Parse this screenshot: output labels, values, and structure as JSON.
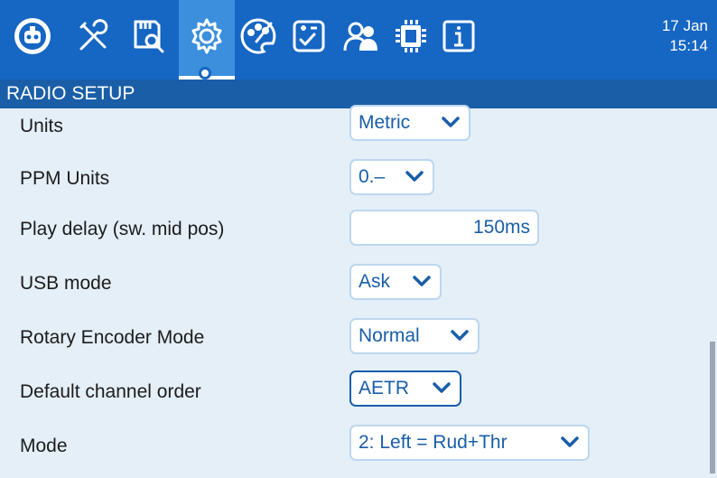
{
  "header": {
    "date": "17 Jan",
    "time": "15:14",
    "tabs": [
      {
        "icon": "radio-icon"
      },
      {
        "icon": "tools-icon"
      },
      {
        "icon": "sd-card-icon"
      },
      {
        "icon": "gear-icon",
        "active": true
      },
      {
        "icon": "theme-palette-icon"
      },
      {
        "icon": "checklist-icon"
      },
      {
        "icon": "users-icon"
      },
      {
        "icon": "hardware-chip-icon"
      },
      {
        "icon": "info-icon"
      }
    ]
  },
  "page": {
    "title": "RADIO SETUP"
  },
  "settings": [
    {
      "label": "Units",
      "value": "Metric",
      "type": "select"
    },
    {
      "label": "PPM Units",
      "value": "0.–",
      "type": "select"
    },
    {
      "label": "Play delay (sw. mid pos)",
      "value": "150ms",
      "type": "number"
    },
    {
      "label": "USB mode",
      "value": "Ask",
      "type": "select"
    },
    {
      "label": "Rotary Encoder Mode",
      "value": "Normal",
      "type": "select"
    },
    {
      "label": "Default channel order",
      "value": "AETR",
      "type": "select",
      "focused": true
    },
    {
      "label": "Mode",
      "value": "2: Left = Rud+Thr",
      "type": "select"
    }
  ],
  "colors": {
    "header_bg": "#1666c3",
    "title_bg": "#1a5ea8",
    "content_bg": "#e4eff8",
    "accent": "#1a5ea8"
  }
}
